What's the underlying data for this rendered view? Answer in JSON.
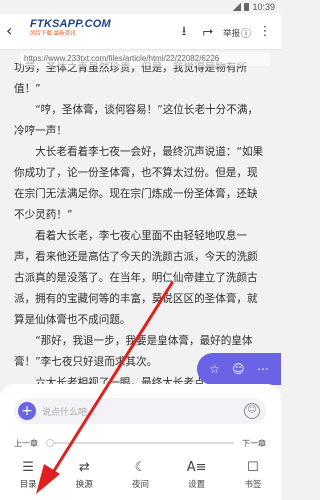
{
  "status": {
    "time": "10:39"
  },
  "toolbar": {
    "logo_main": "FTKSAPP.COM",
    "logo_sub": "风铃下载 最新资讯",
    "report_label": "举报"
  },
  "url": "https://www.233txt.com/files/article/html/22/22082/6226",
  "content": [
    {
      "indent": false,
      "text": "功劳，圣体之青虽然珍贵，但是，我觉得是物有所值！”"
    },
    {
      "indent": true,
      "text": "“哼，圣体膏，谈何容易！”这位长老十分不满，冷哼一声！"
    },
    {
      "indent": true,
      "text": "大长老看着李七夜一会好，最终沉声说道：“如果你成功了，论一份圣体膏，也不算太过份。但是，现在宗门无法满足你。现在宗门炼成一份圣体膏，还缺不少灵药！”"
    },
    {
      "indent": true,
      "text": "看着大长老，李七夜心里面不由轻轻地叹息一声，看来他还是高估了今天的洗颜古派，今天的洗颜古派真的是没落了。在当年，明仁仙帝建立了洗颜古派，拥有的宝藏何等的丰富，莫说区区的圣体膏，就算是仙体膏也不成问题。"
    },
    {
      "indent": true,
      "text": "“那好，我退一步，我要是皇体膏，最好的皇体膏！”李七夜只好退而求其次。"
    },
    {
      "indent": true,
      "text": "六大长老相视了一眼，最终大长老点头说道：“这个我可以答应你，前提你能成功！”"
    }
  ],
  "comment": {
    "placeholder": "说点什么吧..."
  },
  "chapter_nav": {
    "prev": "上一章",
    "next": "下一章",
    "progress": 0.0
  },
  "bottom_nav": [
    {
      "label": "目录",
      "icon": "list-icon"
    },
    {
      "label": "换源",
      "icon": "swap-icon"
    },
    {
      "label": "夜间",
      "icon": "moon-icon"
    },
    {
      "label": "设置",
      "icon": "font-settings-icon"
    },
    {
      "label": "书签",
      "icon": "bookmark-icon"
    }
  ],
  "colors": {
    "accent": "#6b63e6",
    "arrow": "#e02020"
  }
}
